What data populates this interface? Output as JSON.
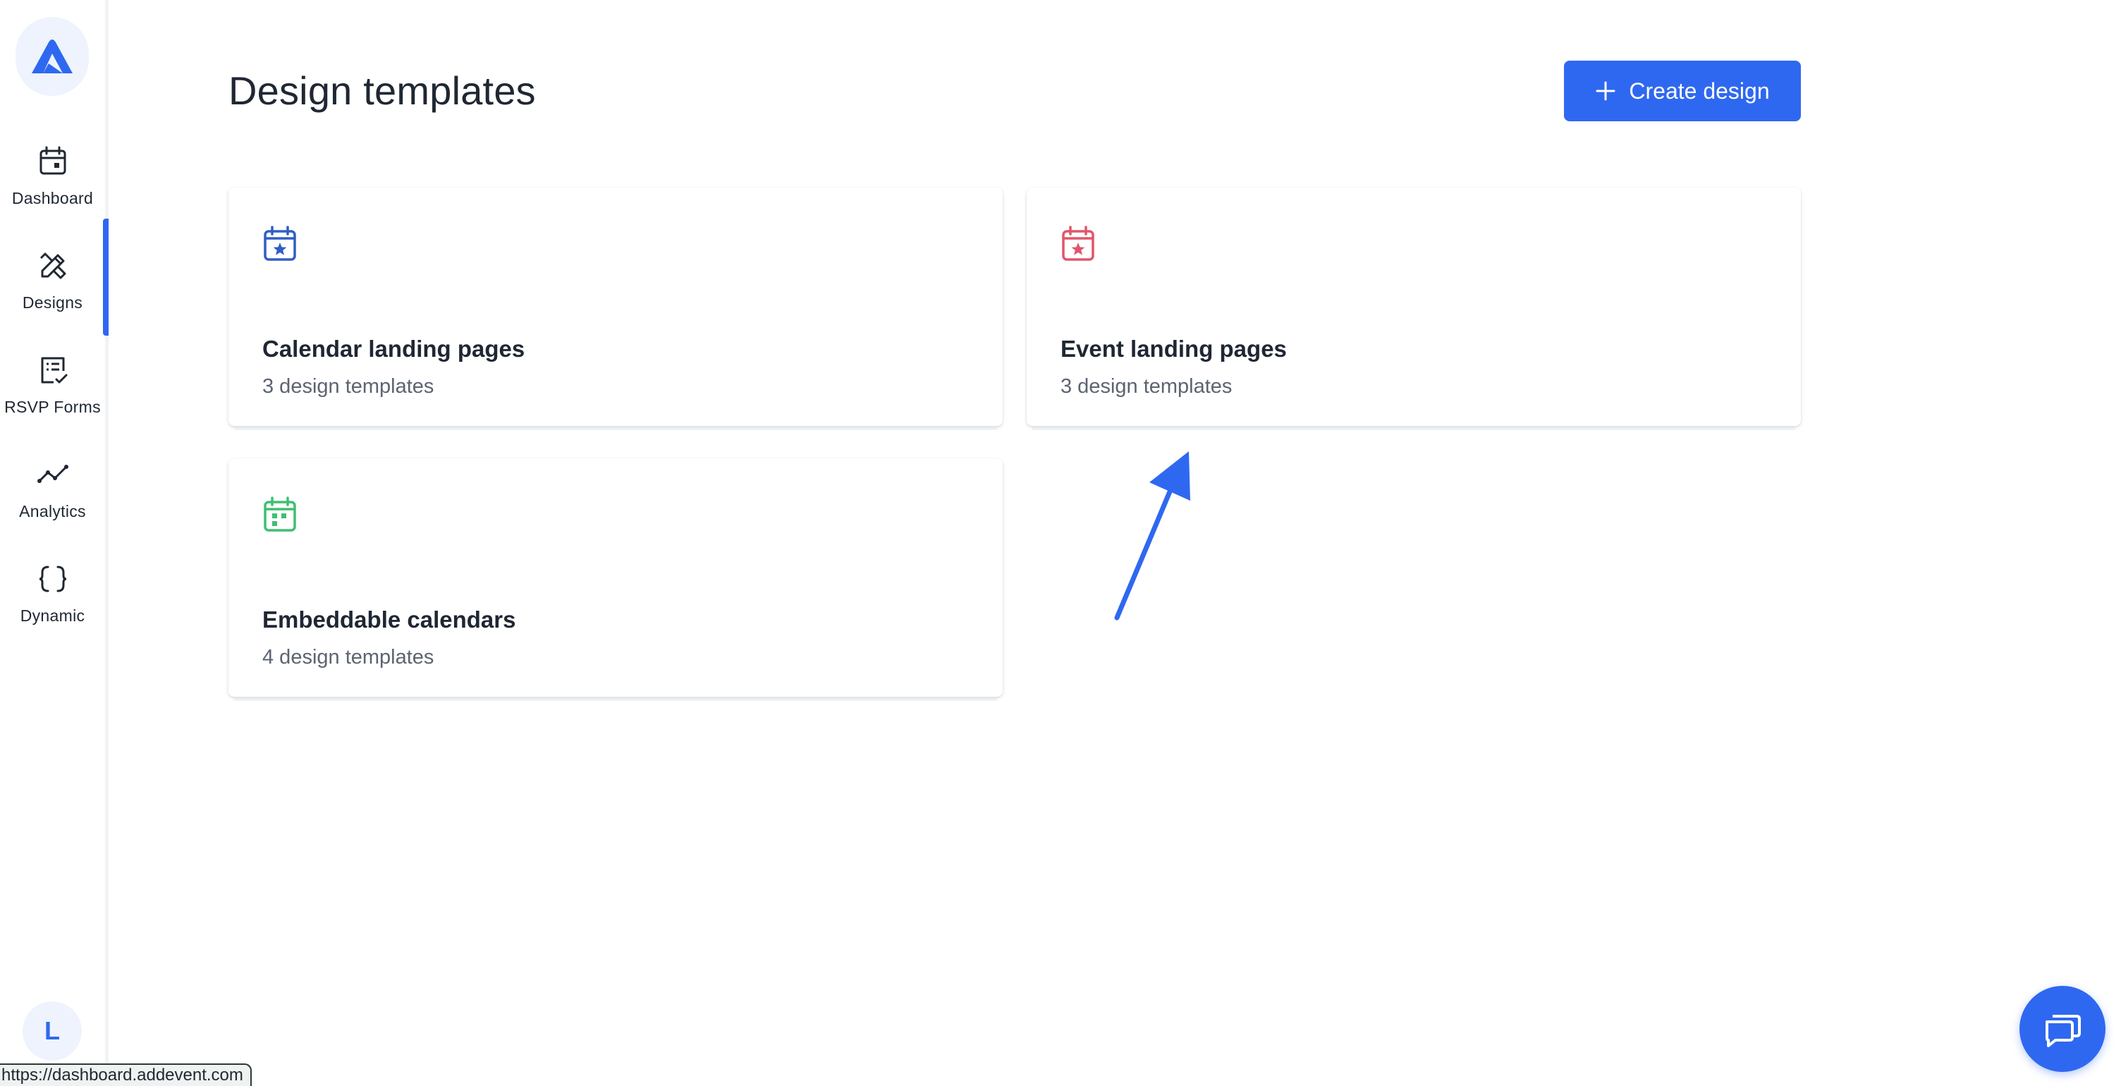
{
  "sidebar": {
    "items": [
      {
        "label": "Dashboard",
        "icon": "calendar-icon"
      },
      {
        "label": "Designs",
        "icon": "design-tools-icon"
      },
      {
        "label": "RSVP Forms",
        "icon": "form-check-icon"
      },
      {
        "label": "Analytics",
        "icon": "chart-line-icon"
      },
      {
        "label": "Dynamic",
        "icon": "braces-icon"
      }
    ],
    "active": "Designs",
    "avatar_initial": "L"
  },
  "header": {
    "title": "Design templates",
    "create_button_label": "Create design"
  },
  "cards": [
    {
      "title": "Calendar landing pages",
      "subtitle": "3 design templates",
      "icon": "calendar-star-icon",
      "color": "#2f5fc4"
    },
    {
      "title": "Event landing pages",
      "subtitle": "3 design templates",
      "icon": "calendar-star-icon",
      "color": "#e0566c"
    },
    {
      "title": "Embeddable calendars",
      "subtitle": "4 design templates",
      "icon": "calendar-grid-icon",
      "color": "#3fbf72"
    }
  ],
  "status_bar": {
    "url": "https://dashboard.addevent.com"
  },
  "colors": {
    "accent": "#2f68f0",
    "text": "#1f2733",
    "muted": "#5c6470"
  }
}
